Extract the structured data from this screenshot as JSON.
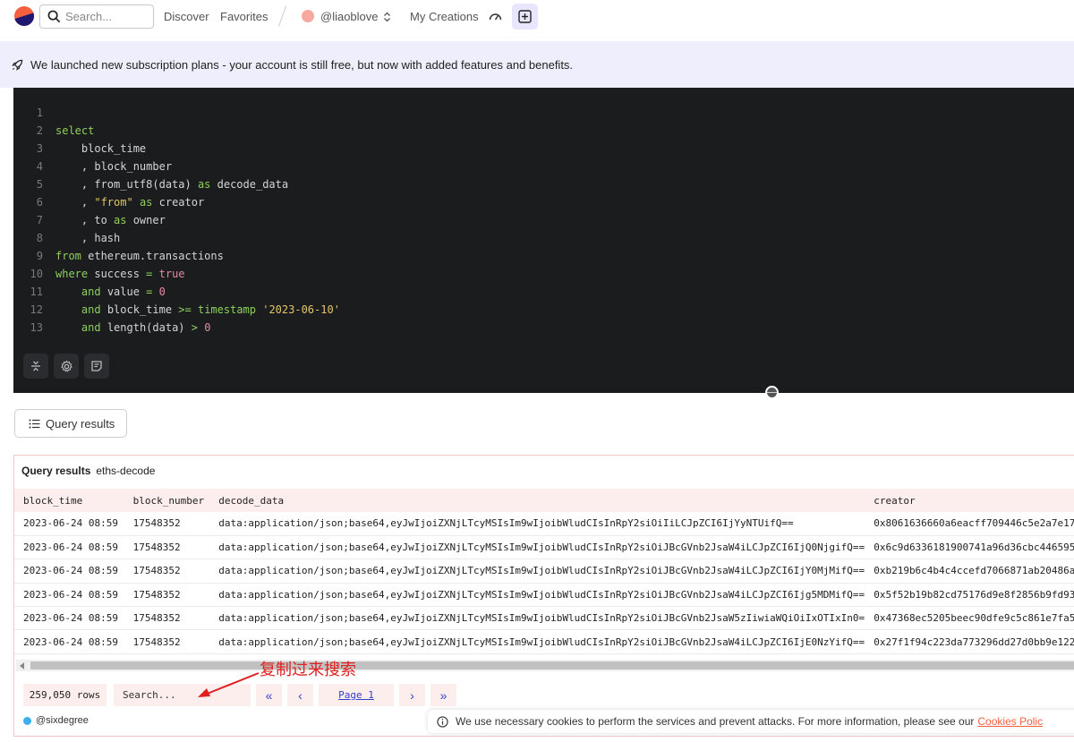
{
  "nav": {
    "search_placeholder": "Search...",
    "discover": "Discover",
    "favorites": "Favorites",
    "user": "@liaoblove",
    "my_creations": "My Creations"
  },
  "banner": {
    "text": "We launched new subscription plans - your account is still free, but now with added features and benefits."
  },
  "editor": {
    "lines": [
      {
        "n": "1"
      },
      {
        "n": "2"
      },
      {
        "n": "3"
      },
      {
        "n": "4"
      },
      {
        "n": "5"
      },
      {
        "n": "6"
      },
      {
        "n": "7"
      },
      {
        "n": "8"
      },
      {
        "n": "9"
      },
      {
        "n": "10"
      },
      {
        "n": "11"
      },
      {
        "n": "12"
      },
      {
        "n": "13"
      }
    ],
    "code": {
      "l2_select": "select",
      "l3_block_time": "block_time",
      "l4": ", block_number",
      "l5_a": ", from_utf8(data) ",
      "l5_as": "as",
      "l5_b": " decode_data",
      "l6_a": ", ",
      "l6_str": "\"from\"",
      "l6_as": " as",
      "l6_b": " creator",
      "l7_a": ", to ",
      "l7_as": "as",
      "l7_b": " owner",
      "l8": ", hash",
      "l9_from": "from",
      "l9_b": " ethereum.transactions",
      "l10_where": "where",
      "l10_b": " success ",
      "l10_eq": "=",
      "l10_true": " true",
      "l11_and": "and",
      "l11_b": " value ",
      "l11_eq": "=",
      "l11_zero": " 0",
      "l12_and": "and",
      "l12_b": " block_time ",
      "l12_ge": ">=",
      "l12_ts": " timestamp",
      "l12_str": " '2023-06-10'",
      "l13_and": "and",
      "l13_b": " length(data) ",
      "l13_gt": ">",
      "l13_zero": " 0"
    }
  },
  "results_tab": {
    "label": "Query results"
  },
  "results": {
    "title": "Query results",
    "query_name": "eths-decode",
    "columns": [
      "block_time",
      "block_number",
      "decode_data",
      "creator"
    ],
    "rows": [
      [
        "2023-06-24 08:59",
        "17548352",
        "data:application/json;base64,eyJwIjoiZXNjLTcyMSIsIm9wIjoibWludCIsInRpY2siOiIiLCJpZCI6IjYyNTUifQ==",
        "0x8061636660a6eacff709446c5e2a7e17"
      ],
      [
        "2023-06-24 08:59",
        "17548352",
        "data:application/json;base64,eyJwIjoiZXNjLTcyMSIsIm9wIjoibWludCIsInRpY2siOiJBcGVnb2JsaW4iLCJpZCI6IjQ0NjgifQ==",
        "0x6c9d6336181900741a96d36cbc446595"
      ],
      [
        "2023-06-24 08:59",
        "17548352",
        "data:application/json;base64,eyJwIjoiZXNjLTcyMSIsIm9wIjoibWludCIsInRpY2siOiJBcGVnb2JsaW4iLCJpZCI6IjY0MjMifQ==",
        "0xb219b6c4b4c4ccefd7066871ab20486a"
      ],
      [
        "2023-06-24 08:59",
        "17548352",
        "data:application/json;base64,eyJwIjoiZXNjLTcyMSIsIm9wIjoibWludCIsInRpY2siOiJBcGVnb2JsaW4iLCJpZCI6Ijg5MDMifQ==",
        "0x5f52b19b82cd75176d9e8f2856b9fd93"
      ],
      [
        "2023-06-24 08:59",
        "17548352",
        "data:application/json;base64,eyJwIjoiZXNjLTcyMSIsIm9wIjoibWludCIsInRpY2siOiJBcGVnb2JsaW5zIiwiaWQiOiIxOTIxIn0=",
        "0x47368ec5205beec90dfe9c5c861e7fa5"
      ],
      [
        "2023-06-24 08:59",
        "17548352",
        "data:application/json;base64,eyJwIjoiZXNjLTcyMSIsIm9wIjoibWludCIsInRpY2siOiJBcGVnb2JsaW4iLCJpZCI6IjE0NzYifQ==",
        "0x27f1f94c223da773296dd27d0bb9e122"
      ]
    ],
    "pager": {
      "rows": "259,050 rows",
      "search_placeholder": "Search...",
      "page": "Page 1"
    },
    "owner": "@sixdegree"
  },
  "annotation": {
    "text": "复制过来搜索"
  },
  "cookie": {
    "text": "We use necessary cookies to perform the services and prevent attacks. For more information, please see our",
    "link": "Cookies Polic"
  },
  "colors": {
    "brand_orange": "#f4603e",
    "brand_navy": "#1e1870",
    "banner_bg": "#eeeefc",
    "editor_bg": "#1b1c1e",
    "header_row_bg": "#fdeeee",
    "annotation_red": "#e02020"
  }
}
